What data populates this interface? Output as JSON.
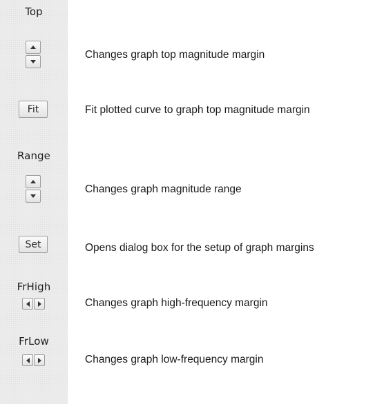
{
  "controls": {
    "top": {
      "label": "Top",
      "description": "Changes graph top magnitude margin"
    },
    "fit": {
      "label": "Fit",
      "description": "Fit plotted curve to graph top magnitude margin"
    },
    "range": {
      "label": "Range",
      "description": "Changes  graph magnitude range"
    },
    "set": {
      "label": "Set",
      "description": "Opens dialog box for the setup of graph margins"
    },
    "frhigh": {
      "label": "FrHigh",
      "description": "Changes  graph high-frequency margin"
    },
    "frlow": {
      "label": "FrLow",
      "description": "Changes graph low-frequency margin"
    }
  },
  "icons": [
    "up-arrow-icon",
    "down-arrow-icon",
    "left-arrow-icon",
    "right-arrow-icon"
  ]
}
